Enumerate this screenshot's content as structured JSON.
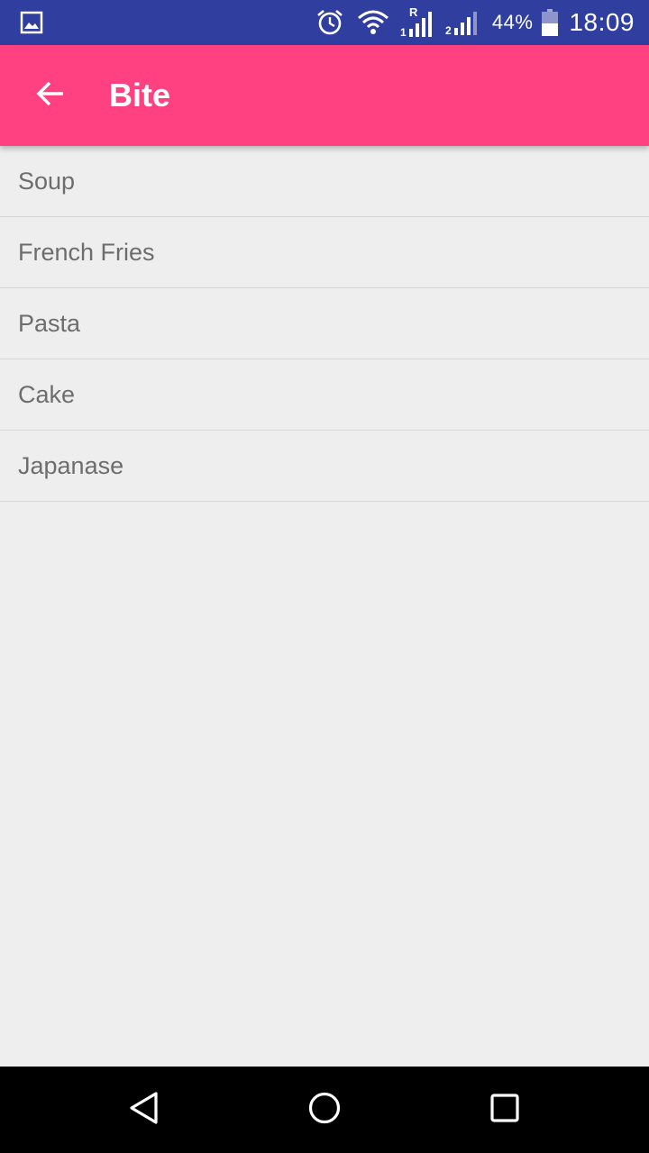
{
  "status_bar": {
    "left_icon": "image-icon",
    "icons": [
      "alarm-icon",
      "wifi-icon",
      "signal-sim1-icon",
      "signal-sim2-icon",
      "battery-icon"
    ],
    "sim1_label": "1",
    "sim1_roaming": "R",
    "sim2_label": "2",
    "battery_percent": "44%",
    "time": "18:09"
  },
  "app_bar": {
    "title": "Bite",
    "background_color": "#ff4081",
    "back_icon": "arrow-back-icon"
  },
  "list": {
    "items": [
      {
        "label": "Soup"
      },
      {
        "label": "French Fries"
      },
      {
        "label": "Pasta"
      },
      {
        "label": "Cake"
      },
      {
        "label": "Japanase"
      }
    ]
  },
  "nav_bar": {
    "icons": [
      "nav-back-icon",
      "nav-home-icon",
      "nav-recents-icon"
    ]
  }
}
